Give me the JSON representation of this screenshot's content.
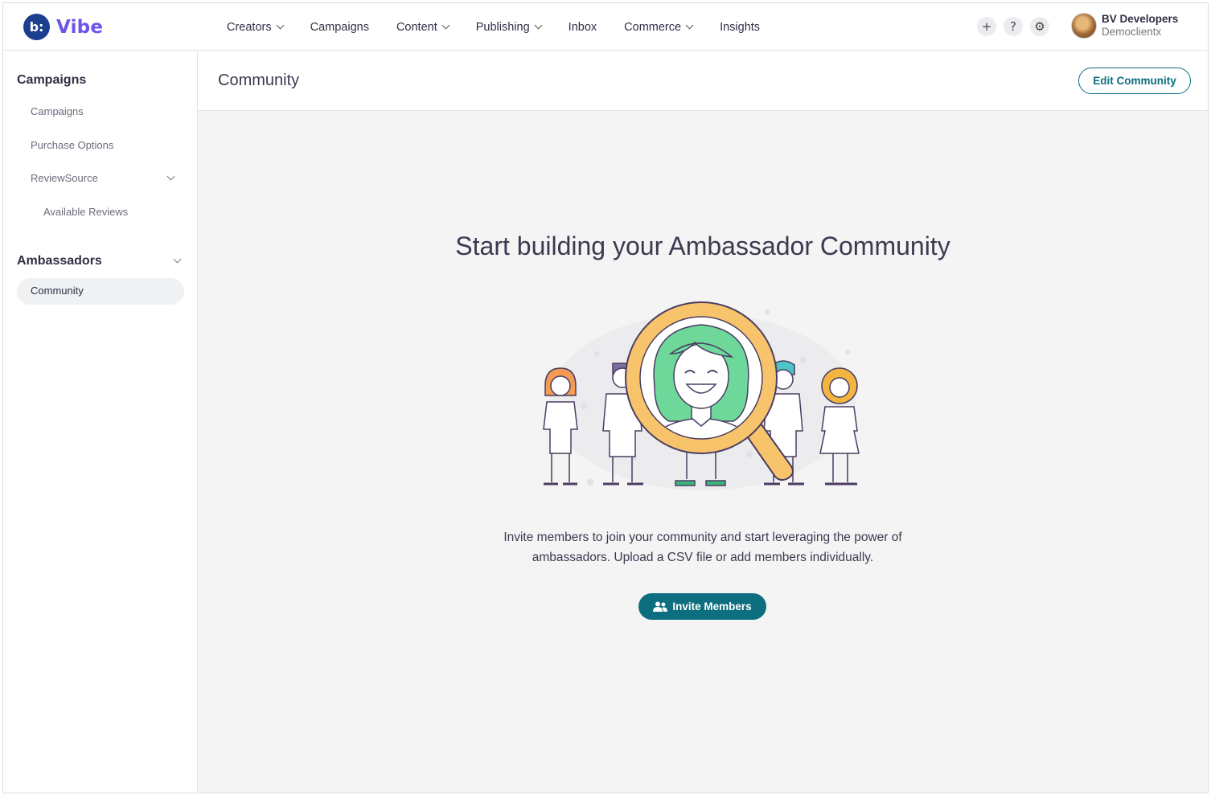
{
  "brand": {
    "badge": "b:",
    "name": "Vibe"
  },
  "nav": {
    "items": [
      {
        "label": "Creators",
        "has_dropdown": true
      },
      {
        "label": "Campaigns",
        "has_dropdown": false
      },
      {
        "label": "Content",
        "has_dropdown": true
      },
      {
        "label": "Publishing",
        "has_dropdown": true
      },
      {
        "label": "Inbox",
        "has_dropdown": false
      },
      {
        "label": "Commerce",
        "has_dropdown": true
      },
      {
        "label": "Insights",
        "has_dropdown": false
      }
    ],
    "tools": [
      {
        "icon": "plus-icon",
        "glyph": "+"
      },
      {
        "icon": "help-icon",
        "glyph": "?"
      },
      {
        "icon": "gear-icon",
        "glyph": "⚙"
      }
    ]
  },
  "user": {
    "name": "BV Developers",
    "org": "Democlientx"
  },
  "sidebar": {
    "campaigns_heading": "Campaigns",
    "campaigns_items": [
      "Campaigns",
      "Purchase Options"
    ],
    "reviewsource_label": "ReviewSource",
    "reviewsource_sub": "Available Reviews",
    "ambassadors_heading": "Ambassadors",
    "active_item": "Community"
  },
  "page": {
    "title": "Community",
    "edit_button": "Edit Community"
  },
  "empty_state": {
    "title": "Start building your Ambassador Community",
    "description_line1": "Invite members to join your community and start leveraging the power of",
    "description_line2": "ambassadors. Upload a CSV file or add members individually.",
    "invite_button": "Invite Members"
  },
  "colors": {
    "accent": "#0c6e7e",
    "brand_badge": "#1d3f8f",
    "illus_green": "#6ed89a",
    "illus_orange": "#f7c46c"
  }
}
